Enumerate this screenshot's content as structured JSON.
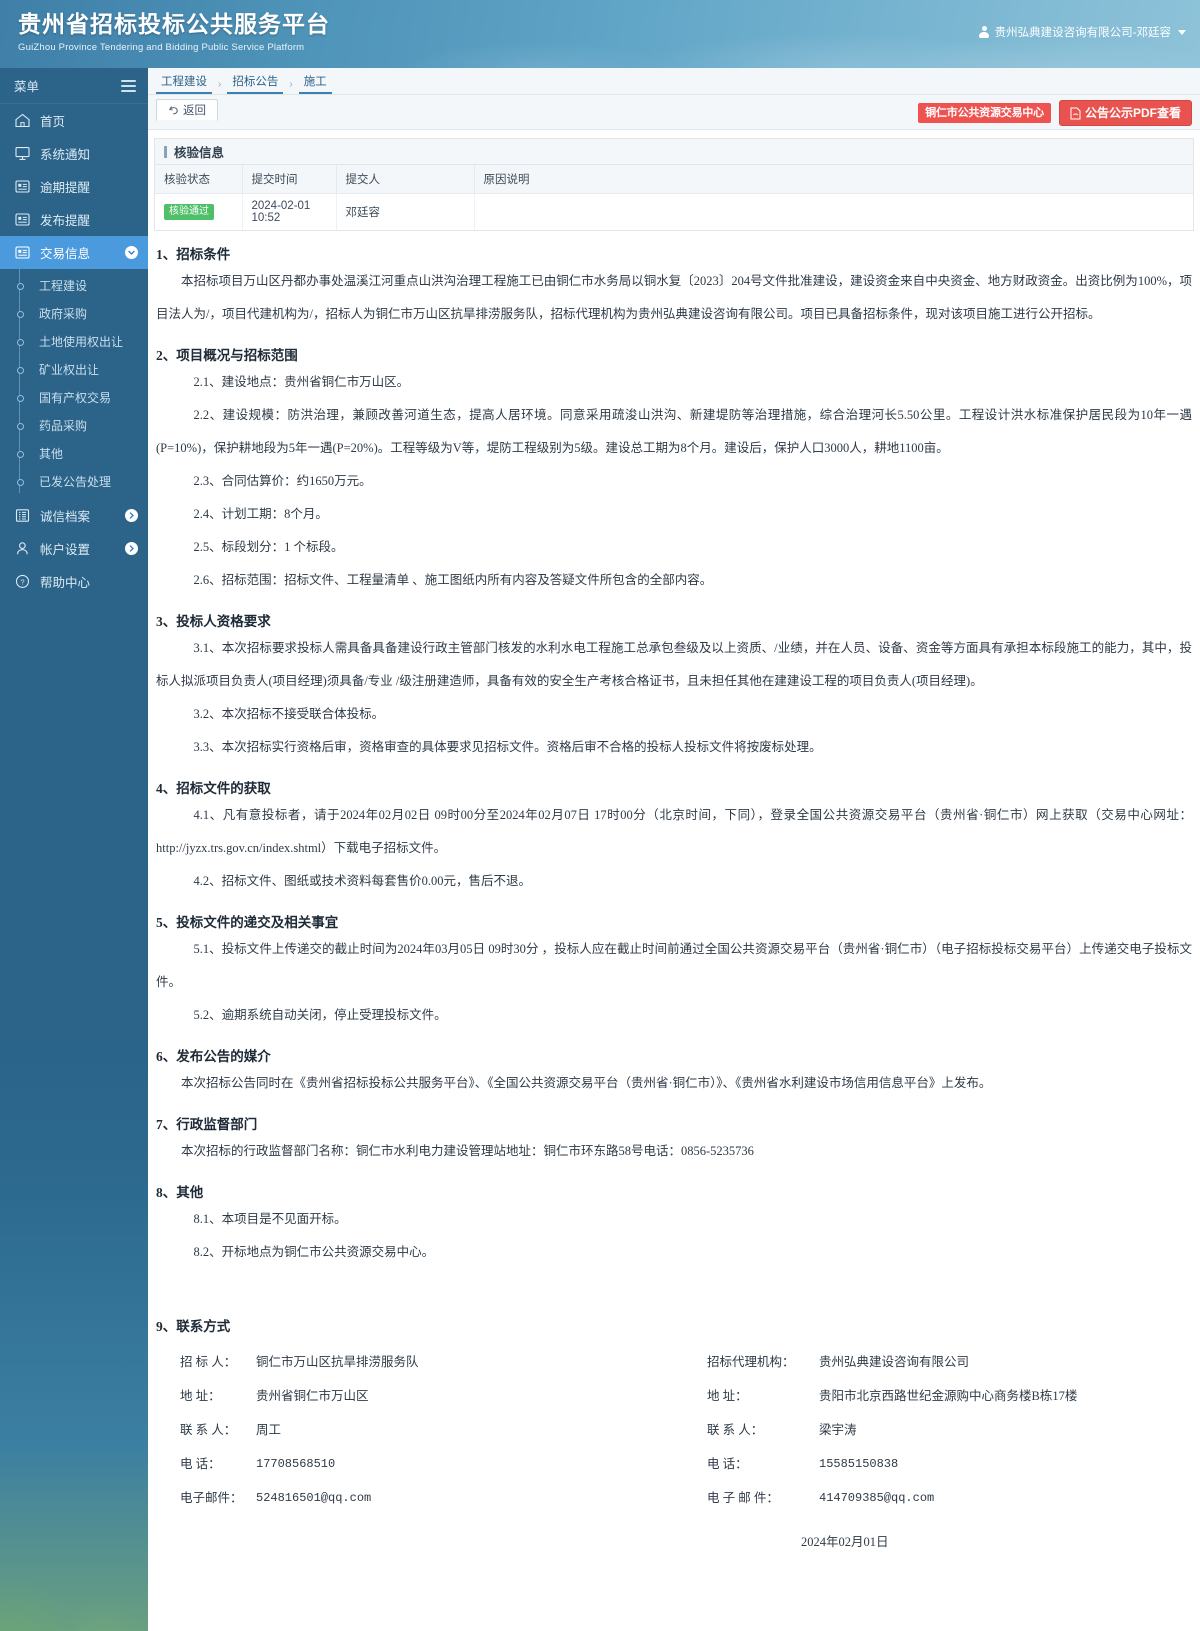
{
  "header": {
    "brand_cn": "贵州省招标投标公共服务平台",
    "brand_en": "GuiZhou Province Tendering and Bidding Public Service Platform",
    "user_label": "贵州弘典建设咨询有限公司-邓廷容",
    "user_icon": "user-icon",
    "caret_icon": "chevron-down-icon"
  },
  "sidebar": {
    "menu_label": "菜单",
    "hamburger_icon": "hamburger-icon",
    "items": [
      {
        "label": "首页",
        "icon": "home-icon",
        "active": false
      },
      {
        "label": "系统通知",
        "icon": "monitor-icon",
        "active": false
      },
      {
        "label": "逾期提醒",
        "icon": "list-box-icon",
        "active": false
      },
      {
        "label": "发布提醒",
        "icon": "list-box-icon",
        "active": false
      },
      {
        "label": "交易信息",
        "icon": "list-box-icon",
        "active": true,
        "expand_icon": "chevron-down-circle-icon"
      }
    ],
    "sub_items": [
      "工程建设",
      "政府采购",
      "土地使用权出让",
      "矿业权出让",
      "国有产权交易",
      "药品采购",
      "其他",
      "已发公告处理"
    ],
    "bottom_items": [
      {
        "label": "诚信档案",
        "icon": "archive-icon",
        "expand_icon": "chevron-right-circle-icon"
      },
      {
        "label": "帐户设置",
        "icon": "person-icon",
        "expand_icon": "chevron-right-circle-icon"
      },
      {
        "label": "帮助中心",
        "icon": "question-circle-icon",
        "expand_icon": ""
      }
    ]
  },
  "breadcrumb": {
    "items": [
      "工程建设",
      "招标公告",
      "施工"
    ],
    "separator": "›"
  },
  "toolbar": {
    "back_label": "返回",
    "back_icon": "undo-icon",
    "center_badge_label": "铜仁市公共资源交易中心",
    "pdf_button_label": "公告公示PDF查看",
    "pdf_icon": "pdf-icon",
    "accent_red": "#e8534f",
    "accent_red_light": "#ef5350"
  },
  "verify_panel": {
    "title": "核验信息",
    "columns": [
      "核验状态",
      "提交时间",
      "提交人",
      "原因说明"
    ],
    "rows": [
      {
        "status": "核验通过",
        "status_color": "#4fbf6a",
        "submit_time": "2024-02-01 10:52",
        "submitter": "邓廷容",
        "reason": ""
      }
    ]
  },
  "document": {
    "sections": [
      {
        "heading": "1、招标条件",
        "paragraphs": [
          "本招标项目万山区丹都办事处温溪江河重点山洪沟治理工程施工已由铜仁市水务局以铜水复〔2023〕204号文件批准建设，建设资金来自中央资金、地方财政资金。出资比例为100%，项目法人为/，项目代建机构为/，招标人为铜仁市万山区抗旱排涝服务队，招标代理机构为贵州弘典建设咨询有限公司。项目已具备招标条件，现对该项目施工进行公开招标。"
        ]
      },
      {
        "heading": "2、项目概况与招标范围",
        "sub_paragraphs": [
          "2.1、建设地点：贵州省铜仁市万山区。",
          "2.2、建设规模：防洪治理，兼顾改善河道生态，提高人居环境。同意采用疏浚山洪沟、新建堤防等治理措施，综合治理河长5.50公里。工程设计洪水标准保护居民段为10年一遇(P=10%)，保护耕地段为5年一遇(P=20%)。工程等级为V等，堤防工程级别为5级。建设总工期为8个月。建设后，保护人口3000人，耕地1100亩。",
          "2.3、合同估算价：约1650万元。",
          "2.4、计划工期：8个月。",
          "2.5、标段划分：1 个标段。",
          "2.6、招标范围：招标文件、工程量清单 、施工图纸内所有内容及答疑文件所包含的全部内容。"
        ]
      },
      {
        "heading": "3、投标人资格要求",
        "sub_paragraphs": [
          "3.1、本次招标要求投标人需具备具备建设行政主管部门核发的水利水电工程施工总承包叁级及以上资质、/业绩，并在人员、设备、资金等方面具有承担本标段施工的能力，其中，投标人拟派项目负责人(项目经理)须具备/专业 /级注册建造师，具备有效的安全生产考核合格证书，且未担任其他在建建设工程的项目负责人(项目经理)。",
          "3.2、本次招标不接受联合体投标。",
          "3.3、本次招标实行资格后审，资格审查的具体要求见招标文件。资格后审不合格的投标人投标文件将按废标处理。"
        ]
      },
      {
        "heading": "4、招标文件的获取",
        "sub_paragraphs": [
          "4.1、凡有意投标者，请于2024年02月02日 09时00分至2024年02月07日 17时00分（北京时间，下同），登录全国公共资源交易平台（贵州省·铜仁市）网上获取（交易中心网址：http://jyzx.trs.gov.cn/index.shtml）下载电子招标文件。",
          "4.2、招标文件、图纸或技术资料每套售价0.00元，售后不退。"
        ]
      },
      {
        "heading": "5、投标文件的递交及相关事宜",
        "sub_paragraphs": [
          "5.1、投标文件上传递交的截止时间为2024年03月05日 09时30分 ，投标人应在截止时间前通过全国公共资源交易平台（贵州省·铜仁市）（电子招标投标交易平台）上传递交电子投标文件。",
          "5.2、逾期系统自动关闭，停止受理投标文件。"
        ]
      },
      {
        "heading": "6、发布公告的媒介",
        "paragraphs": [
          "本次招标公告同时在《贵州省招标投标公共服务平台》、《全国公共资源交易平台（贵州省·铜仁市）》、《贵州省水利建设市场信用信息平台》上发布。"
        ]
      },
      {
        "heading": "7、行政监督部门",
        "paragraphs": [
          "本次招标的行政监督部门名称：铜仁市水利电力建设管理站地址：铜仁市环东路58号电话：0856-5235736"
        ]
      },
      {
        "heading": "8、其他",
        "sub_paragraphs": [
          "8.1、本项目是不见面开标。",
          "8.2、开标地点为铜仁市公共资源交易中心。"
        ]
      }
    ],
    "contact": {
      "heading": "9、联系方式",
      "left": [
        {
          "key": "招 标 人：",
          "value": "铜仁市万山区抗旱排涝服务队",
          "mono": false
        },
        {
          "key": "地       址：",
          "value": "贵州省铜仁市万山区",
          "mono": false
        },
        {
          "key": "联 系 人：",
          "value": "周工",
          "mono": false
        },
        {
          "key": "电     话：",
          "value": "17708568510",
          "mono": true
        },
        {
          "key": "电子邮件：",
          "value": "524816501@qq.com",
          "mono": true
        }
      ],
      "right": [
        {
          "key": "招标代理机构：",
          "value": "贵州弘典建设咨询有限公司",
          "mono": false
        },
        {
          "key": "地          址：",
          "value": "贵阳市北京西路世纪金源购中心商务楼B栋17楼",
          "mono": false
        },
        {
          "key": "联     系     人：",
          "value": "梁宇涛",
          "mono": false
        },
        {
          "key": "电          话：",
          "value": "15585150838",
          "mono": true
        },
        {
          "key": "电 子 邮 件：",
          "value": "414709385@qq.com",
          "mono": true
        }
      ],
      "date": "2024年02月01日"
    }
  }
}
